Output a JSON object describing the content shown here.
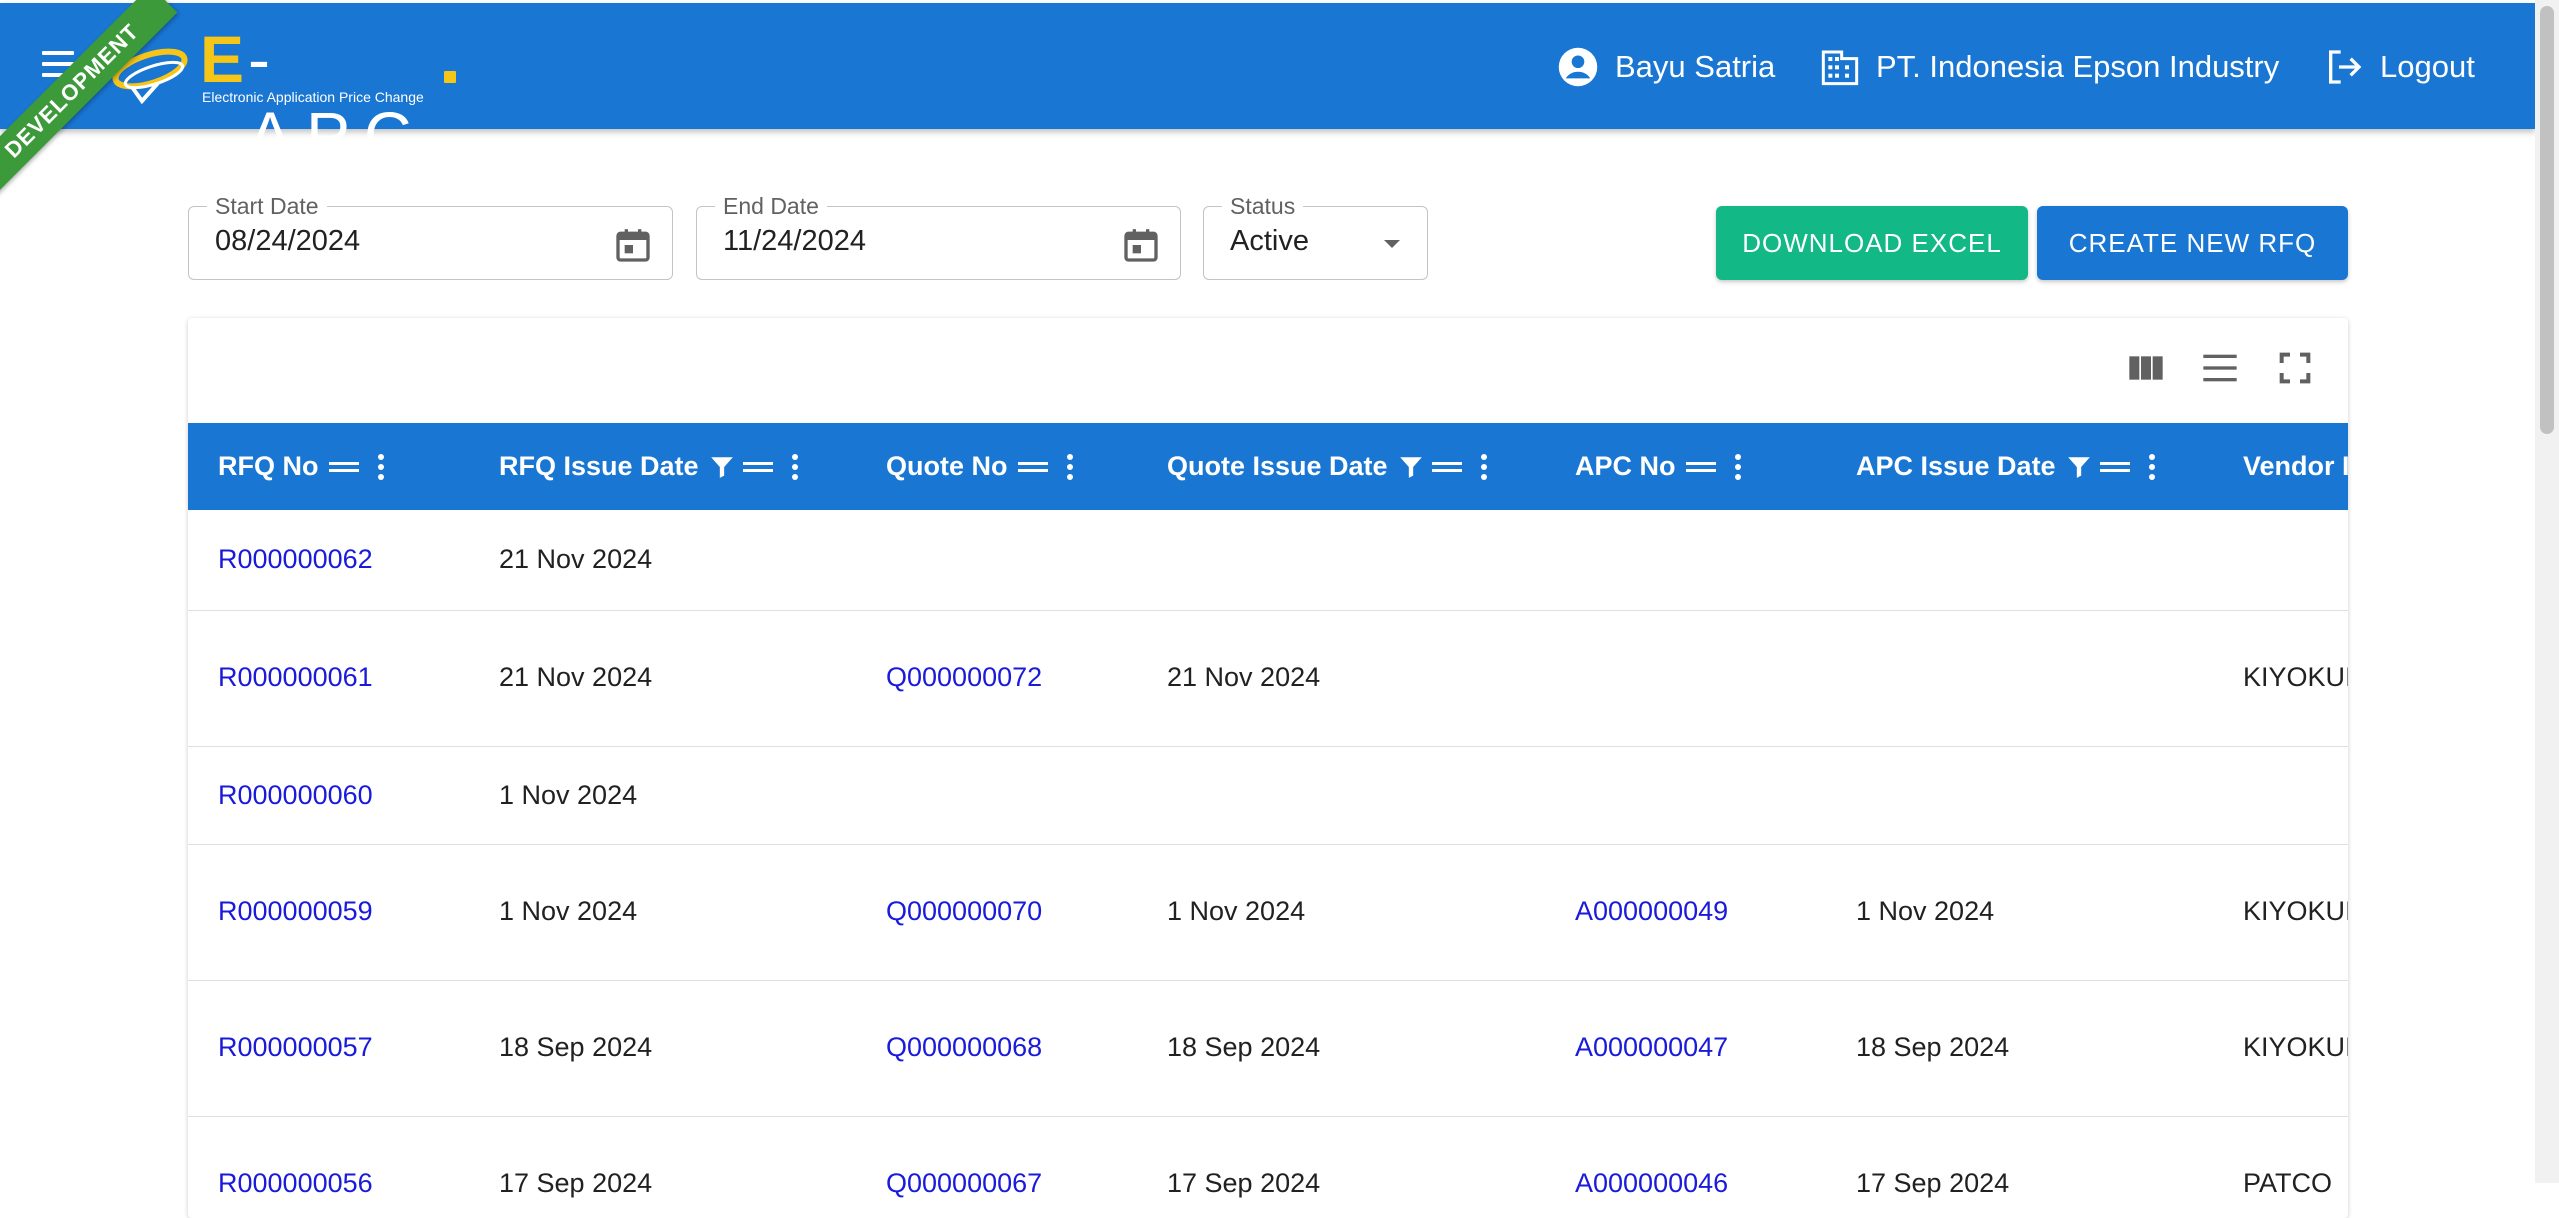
{
  "header": {
    "env_ribbon": "DEVELOPMENT",
    "logo_text_e": "E",
    "logo_text_rest": "- APC",
    "logo_subtitle": "Electronic Application Price Change",
    "user_name": "Bayu Satria",
    "company": "PT. Indonesia Epson Industry",
    "logout_label": "Logout",
    "colors": {
      "bar": "#1976d2",
      "accent": "#f5c518",
      "ribbon": "#3d9a3a"
    }
  },
  "filters": {
    "start_date_label": "Start Date",
    "start_date_value": "08/24/2024",
    "end_date_label": "End Date",
    "end_date_value": "11/24/2024",
    "status_label": "Status",
    "status_value": "Active"
  },
  "actions": {
    "download_excel": "DOWNLOAD EXCEL",
    "create_rfq": "CREATE NEW RFQ",
    "colors": {
      "download": "#12b886",
      "create": "#1976d2"
    }
  },
  "toolbar_icons": [
    "columns-icon",
    "density-icon",
    "fullscreen-icon"
  ],
  "table": {
    "columns": [
      "RFQ No",
      "RFQ Issue Date",
      "Quote No",
      "Quote Issue Date",
      "APC No",
      "APC Issue Date",
      "Vendor I"
    ],
    "rows": [
      {
        "rfq_no": "R000000062",
        "rfq_date": "21 Nov 2024",
        "quote_no": "",
        "quote_date": "",
        "apc_no": "",
        "apc_date": "",
        "vendor": ""
      },
      {
        "rfq_no": "R000000061",
        "rfq_date": "21 Nov 2024",
        "quote_no": "Q000000072",
        "quote_date": "21 Nov 2024",
        "apc_no": "",
        "apc_date": "",
        "vendor": "KIYOKUI"
      },
      {
        "rfq_no": "R000000060",
        "rfq_date": "1 Nov 2024",
        "quote_no": "",
        "quote_date": "",
        "apc_no": "",
        "apc_date": "",
        "vendor": ""
      },
      {
        "rfq_no": "R000000059",
        "rfq_date": "1 Nov 2024",
        "quote_no": "Q000000070",
        "quote_date": "1 Nov 2024",
        "apc_no": "A000000049",
        "apc_date": "1 Nov 2024",
        "vendor": "KIYOKUI"
      },
      {
        "rfq_no": "R000000057",
        "rfq_date": "18 Sep 2024",
        "quote_no": "Q000000068",
        "quote_date": "18 Sep 2024",
        "apc_no": "A000000047",
        "apc_date": "18 Sep 2024",
        "vendor": "KIYOKUI"
      },
      {
        "rfq_no": "R000000056",
        "rfq_date": "17 Sep 2024",
        "quote_no": "Q000000067",
        "quote_date": "17 Sep 2024",
        "apc_no": "A000000046",
        "apc_date": "17 Sep 2024",
        "vendor": "PATCO"
      }
    ]
  }
}
